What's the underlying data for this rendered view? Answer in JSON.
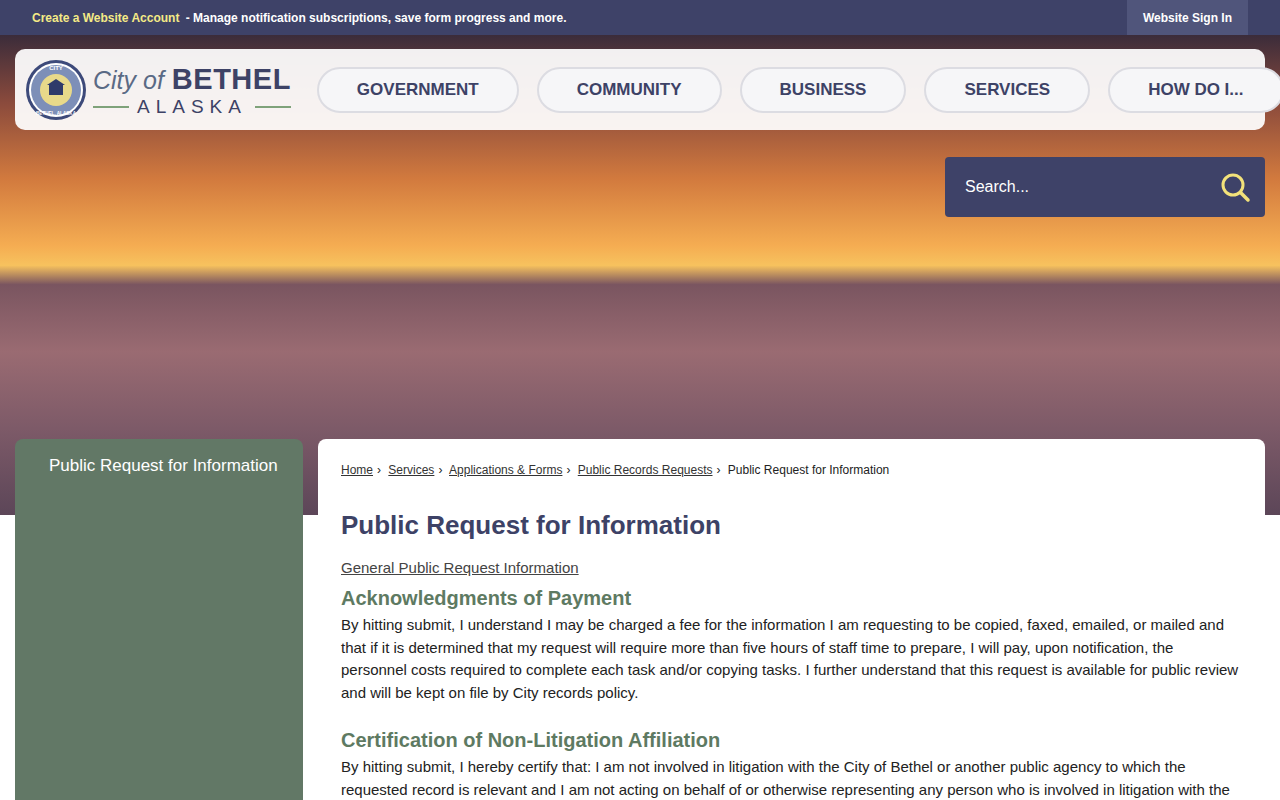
{
  "top_bar": {
    "promo_link": "Create a Website Account",
    "promo_text": "- Manage notification subscriptions, save form progress and more.",
    "sign_in": "Website Sign In"
  },
  "logo": {
    "seal_top": "CITY",
    "seal_bottom": "BETHEL, ALASKA",
    "city_of": "City of",
    "name": "BETHEL",
    "state": "ALASKA"
  },
  "nav": [
    "GOVERNMENT",
    "COMMUNITY",
    "BUSINESS",
    "SERVICES",
    "HOW DO I..."
  ],
  "search": {
    "placeholder": "Search..."
  },
  "sidebar": {
    "items": [
      "Public Request for Information"
    ]
  },
  "breadcrumb": {
    "separator": "›",
    "items": [
      {
        "label": "Home",
        "link": true
      },
      {
        "label": "Services",
        "link": true
      },
      {
        "label": "Applications & Forms",
        "link": true
      },
      {
        "label": "Public Records Requests",
        "link": true
      },
      {
        "label": "Public Request for Information",
        "link": false
      }
    ]
  },
  "page": {
    "title": "Public Request for Information",
    "intro_link": "General Public Request Information",
    "sections": [
      {
        "heading": "Acknowledgments of Payment",
        "body": "By hitting submit, I understand I may be charged a fee for the information I am requesting to be copied, faxed, emailed, or mailed and that if it is determined that my request will require more than five hours of staff time to prepare, I will pay, upon notification, the personnel costs required to complete each task and/or copying tasks. I further understand that this request is available for public review and will be kept on file by City records policy."
      },
      {
        "heading": "Certification of Non-Litigation Affiliation",
        "body": "By hitting submit, I hereby certify that: I am not involved in litigation with the City of Bethel or another public agency to which the requested record is relevant and I am not acting on behalf of or otherwise representing any person who is involved in litigation with the"
      }
    ]
  }
}
